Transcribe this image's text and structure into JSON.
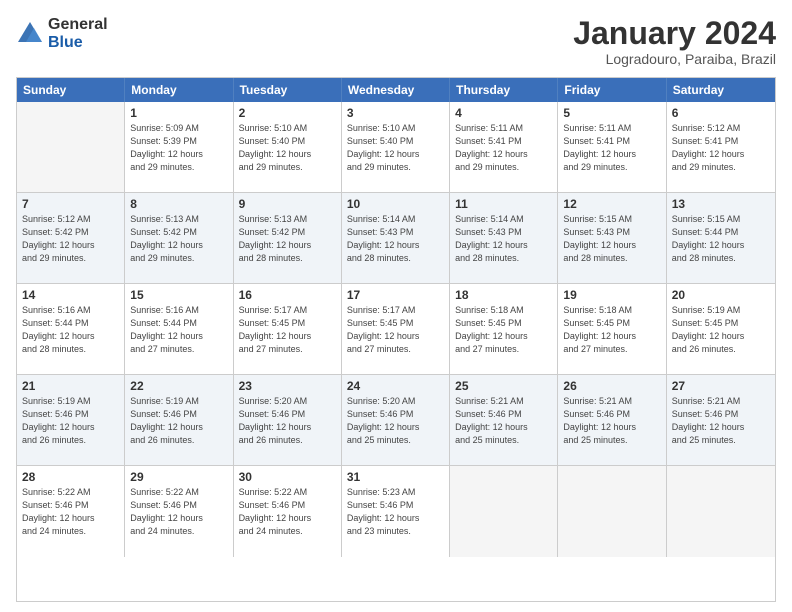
{
  "header": {
    "logo_general": "General",
    "logo_blue": "Blue",
    "month_title": "January 2024",
    "location": "Logradouro, Paraiba, Brazil"
  },
  "calendar": {
    "day_headers": [
      "Sunday",
      "Monday",
      "Tuesday",
      "Wednesday",
      "Thursday",
      "Friday",
      "Saturday"
    ],
    "weeks": [
      [
        {
          "num": "",
          "info": ""
        },
        {
          "num": "1",
          "info": "Sunrise: 5:09 AM\nSunset: 5:39 PM\nDaylight: 12 hours\nand 29 minutes."
        },
        {
          "num": "2",
          "info": "Sunrise: 5:10 AM\nSunset: 5:40 PM\nDaylight: 12 hours\nand 29 minutes."
        },
        {
          "num": "3",
          "info": "Sunrise: 5:10 AM\nSunset: 5:40 PM\nDaylight: 12 hours\nand 29 minutes."
        },
        {
          "num": "4",
          "info": "Sunrise: 5:11 AM\nSunset: 5:41 PM\nDaylight: 12 hours\nand 29 minutes."
        },
        {
          "num": "5",
          "info": "Sunrise: 5:11 AM\nSunset: 5:41 PM\nDaylight: 12 hours\nand 29 minutes."
        },
        {
          "num": "6",
          "info": "Sunrise: 5:12 AM\nSunset: 5:41 PM\nDaylight: 12 hours\nand 29 minutes."
        }
      ],
      [
        {
          "num": "7",
          "info": "Sunrise: 5:12 AM\nSunset: 5:42 PM\nDaylight: 12 hours\nand 29 minutes."
        },
        {
          "num": "8",
          "info": "Sunrise: 5:13 AM\nSunset: 5:42 PM\nDaylight: 12 hours\nand 29 minutes."
        },
        {
          "num": "9",
          "info": "Sunrise: 5:13 AM\nSunset: 5:42 PM\nDaylight: 12 hours\nand 28 minutes."
        },
        {
          "num": "10",
          "info": "Sunrise: 5:14 AM\nSunset: 5:43 PM\nDaylight: 12 hours\nand 28 minutes."
        },
        {
          "num": "11",
          "info": "Sunrise: 5:14 AM\nSunset: 5:43 PM\nDaylight: 12 hours\nand 28 minutes."
        },
        {
          "num": "12",
          "info": "Sunrise: 5:15 AM\nSunset: 5:43 PM\nDaylight: 12 hours\nand 28 minutes."
        },
        {
          "num": "13",
          "info": "Sunrise: 5:15 AM\nSunset: 5:44 PM\nDaylight: 12 hours\nand 28 minutes."
        }
      ],
      [
        {
          "num": "14",
          "info": "Sunrise: 5:16 AM\nSunset: 5:44 PM\nDaylight: 12 hours\nand 28 minutes."
        },
        {
          "num": "15",
          "info": "Sunrise: 5:16 AM\nSunset: 5:44 PM\nDaylight: 12 hours\nand 27 minutes."
        },
        {
          "num": "16",
          "info": "Sunrise: 5:17 AM\nSunset: 5:45 PM\nDaylight: 12 hours\nand 27 minutes."
        },
        {
          "num": "17",
          "info": "Sunrise: 5:17 AM\nSunset: 5:45 PM\nDaylight: 12 hours\nand 27 minutes."
        },
        {
          "num": "18",
          "info": "Sunrise: 5:18 AM\nSunset: 5:45 PM\nDaylight: 12 hours\nand 27 minutes."
        },
        {
          "num": "19",
          "info": "Sunrise: 5:18 AM\nSunset: 5:45 PM\nDaylight: 12 hours\nand 27 minutes."
        },
        {
          "num": "20",
          "info": "Sunrise: 5:19 AM\nSunset: 5:45 PM\nDaylight: 12 hours\nand 26 minutes."
        }
      ],
      [
        {
          "num": "21",
          "info": "Sunrise: 5:19 AM\nSunset: 5:46 PM\nDaylight: 12 hours\nand 26 minutes."
        },
        {
          "num": "22",
          "info": "Sunrise: 5:19 AM\nSunset: 5:46 PM\nDaylight: 12 hours\nand 26 minutes."
        },
        {
          "num": "23",
          "info": "Sunrise: 5:20 AM\nSunset: 5:46 PM\nDaylight: 12 hours\nand 26 minutes."
        },
        {
          "num": "24",
          "info": "Sunrise: 5:20 AM\nSunset: 5:46 PM\nDaylight: 12 hours\nand 25 minutes."
        },
        {
          "num": "25",
          "info": "Sunrise: 5:21 AM\nSunset: 5:46 PM\nDaylight: 12 hours\nand 25 minutes."
        },
        {
          "num": "26",
          "info": "Sunrise: 5:21 AM\nSunset: 5:46 PM\nDaylight: 12 hours\nand 25 minutes."
        },
        {
          "num": "27",
          "info": "Sunrise: 5:21 AM\nSunset: 5:46 PM\nDaylight: 12 hours\nand 25 minutes."
        }
      ],
      [
        {
          "num": "28",
          "info": "Sunrise: 5:22 AM\nSunset: 5:46 PM\nDaylight: 12 hours\nand 24 minutes."
        },
        {
          "num": "29",
          "info": "Sunrise: 5:22 AM\nSunset: 5:46 PM\nDaylight: 12 hours\nand 24 minutes."
        },
        {
          "num": "30",
          "info": "Sunrise: 5:22 AM\nSunset: 5:46 PM\nDaylight: 12 hours\nand 24 minutes."
        },
        {
          "num": "31",
          "info": "Sunrise: 5:23 AM\nSunset: 5:46 PM\nDaylight: 12 hours\nand 23 minutes."
        },
        {
          "num": "",
          "info": ""
        },
        {
          "num": "",
          "info": ""
        },
        {
          "num": "",
          "info": ""
        }
      ]
    ]
  }
}
